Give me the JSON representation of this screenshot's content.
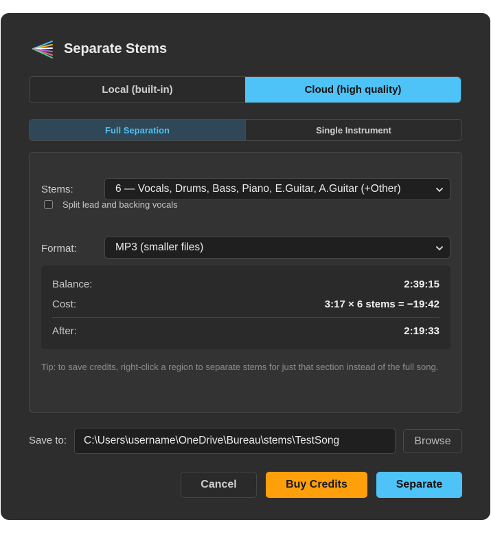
{
  "dialog": {
    "title": "Separate Stems",
    "app_icon": "stems-fan-icon"
  },
  "mode_tabs": [
    {
      "label": "Local (built-in)",
      "selected": false
    },
    {
      "label": "Cloud (high quality)",
      "selected": true
    }
  ],
  "separation_tabs": [
    {
      "label": "Full Separation",
      "selected": true
    },
    {
      "label": "Single Instrument",
      "selected": false
    }
  ],
  "options": {
    "stems_label": "Stems:",
    "stems_value": "6 — Vocals, Drums, Bass, Piano, E.Guitar, A.Guitar (+Other)",
    "split_vocals_label": "Split lead and backing vocals",
    "split_vocals_checked": false,
    "format_label": "Format:",
    "format_value": "MP3 (smaller files)"
  },
  "credits": {
    "balance_label": "Balance:",
    "balance_value": "2:39:15",
    "cost_label": "Cost:",
    "cost_value": "3:17 × 6 stems = −19:42",
    "after_label": "After:",
    "after_value": "2:19:33"
  },
  "tip": "Tip: to save credits, right-click a region to separate stems for just that section instead of the full song.",
  "save": {
    "label": "Save to:",
    "path": "C:\\Users\\username\\OneDrive\\Bureau\\stems\\TestSong",
    "browse_label": "Browse"
  },
  "buttons": {
    "cancel": "Cancel",
    "buy_credits": "Buy Credits",
    "separate": "Separate"
  },
  "colors": {
    "accent": "#4dc3f7",
    "buy": "#ff9f0a",
    "background": "#2d2d2d"
  }
}
